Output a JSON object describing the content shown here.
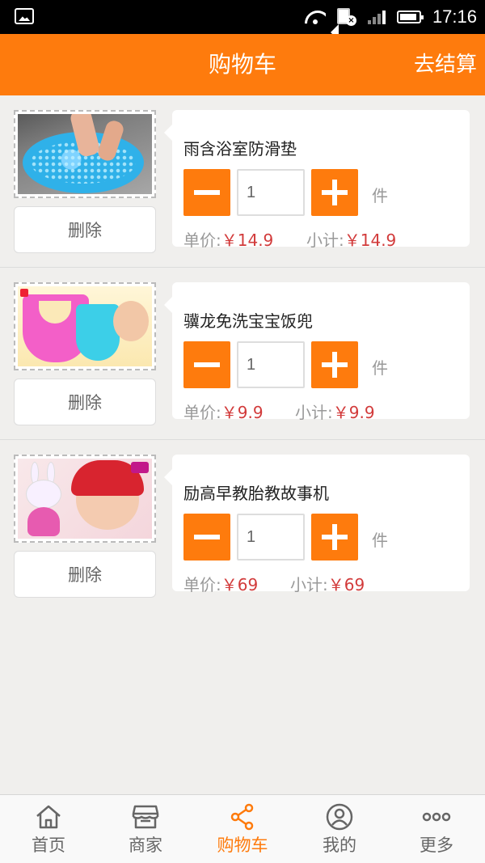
{
  "status_bar": {
    "time": "17:16"
  },
  "header": {
    "title": "购物车",
    "checkout": "去结算"
  },
  "cart": {
    "delete_label": "删除",
    "unit_label": "件",
    "price_label": "单价:",
    "subtotal_label": "小计:",
    "items": [
      {
        "name": "雨含浴室防滑垫",
        "quantity": "1",
        "price": "￥14.9",
        "subtotal": "￥14.9"
      },
      {
        "name": "骥龙免洗宝宝饭兜",
        "quantity": "1",
        "price": "￥9.9",
        "subtotal": "￥9.9"
      },
      {
        "name": "励高早教胎教故事机",
        "quantity": "1",
        "price": "￥69",
        "subtotal": "￥69"
      }
    ]
  },
  "bottom_nav": {
    "items": [
      {
        "label": "首页",
        "icon": "home-icon"
      },
      {
        "label": "商家",
        "icon": "store-icon"
      },
      {
        "label": "购物车",
        "icon": "share-icon"
      },
      {
        "label": "我的",
        "icon": "user-icon"
      },
      {
        "label": "更多",
        "icon": "more-icon"
      }
    ],
    "active_index": 2
  },
  "colors": {
    "accent": "#fe7b0d",
    "price": "#d23b3b",
    "background": "#f0efed"
  }
}
